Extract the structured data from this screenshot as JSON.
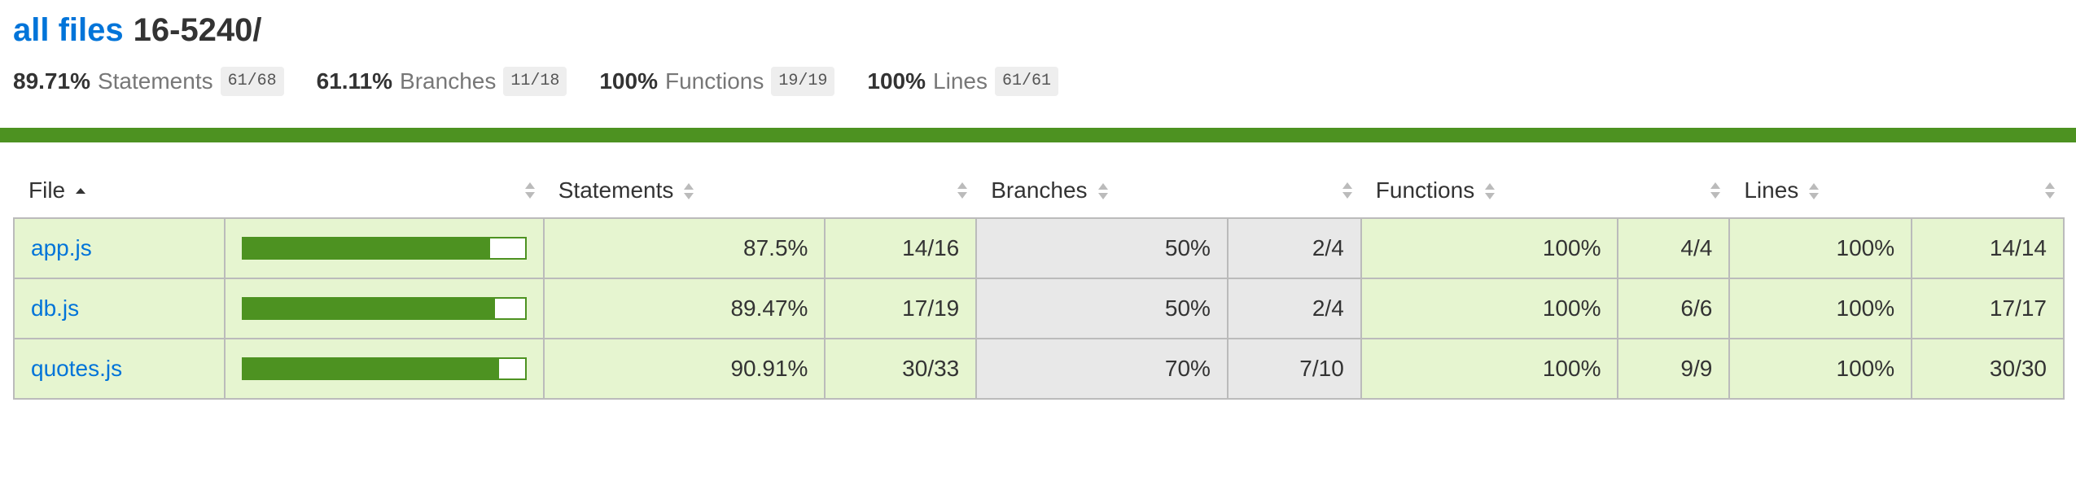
{
  "header": {
    "breadcrumb_root": "all files",
    "current_dir": "16-5240/"
  },
  "summary": [
    {
      "pct": "89.71%",
      "label": "Statements",
      "fraction": "61/68"
    },
    {
      "pct": "61.11%",
      "label": "Branches",
      "fraction": "11/18"
    },
    {
      "pct": "100%",
      "label": "Functions",
      "fraction": "19/19"
    },
    {
      "pct": "100%",
      "label": "Lines",
      "fraction": "61/61"
    }
  ],
  "status_color": "#4d9221",
  "colors": {
    "high": "#e6f5d0",
    "low": "#e8e8e8",
    "link": "#0074d9"
  },
  "table": {
    "headers": {
      "file": "File",
      "statements": "Statements",
      "branches": "Branches",
      "functions": "Functions",
      "lines": "Lines"
    },
    "sort_column": "file",
    "sort_direction": "ascending",
    "rows": [
      {
        "file": "app.js",
        "coverage": 0.875,
        "statements_pct": "87.5%",
        "statements_frac": "14/16",
        "branches_pct": "50%",
        "branches_frac": "2/4",
        "functions_pct": "100%",
        "functions_frac": "4/4",
        "lines_pct": "100%",
        "lines_frac": "14/14"
      },
      {
        "file": "db.js",
        "coverage": 0.8947,
        "statements_pct": "89.47%",
        "statements_frac": "17/19",
        "branches_pct": "50%",
        "branches_frac": "2/4",
        "functions_pct": "100%",
        "functions_frac": "6/6",
        "lines_pct": "100%",
        "lines_frac": "17/17"
      },
      {
        "file": "quotes.js",
        "coverage": 0.9091,
        "statements_pct": "90.91%",
        "statements_frac": "30/33",
        "branches_pct": "70%",
        "branches_frac": "7/10",
        "functions_pct": "100%",
        "functions_frac": "9/9",
        "lines_pct": "100%",
        "lines_frac": "30/30"
      }
    ]
  }
}
